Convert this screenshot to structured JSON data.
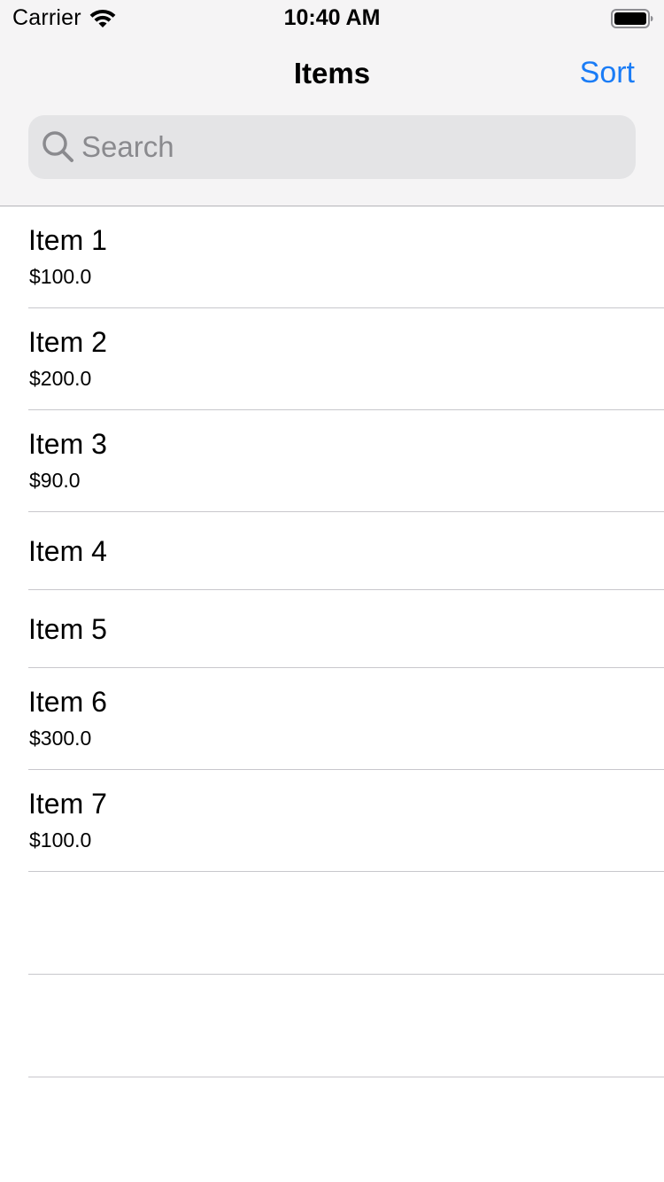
{
  "status_bar": {
    "carrier": "Carrier",
    "time": "10:40 AM",
    "icons": [
      "wifi-icon",
      "battery-icon"
    ]
  },
  "nav": {
    "title": "Items",
    "sort_label": "Sort",
    "accent_color": "#1a7cf6"
  },
  "search": {
    "placeholder": "Search",
    "value": "",
    "icon": "search-icon"
  },
  "items": [
    {
      "title": "Item 1",
      "price": "$100.0"
    },
    {
      "title": "Item 2",
      "price": "$200.0"
    },
    {
      "title": "Item 3",
      "price": "$90.0"
    },
    {
      "title": "Item 4",
      "price": ""
    },
    {
      "title": "Item 5",
      "price": ""
    },
    {
      "title": "Item 6",
      "price": "$300.0"
    },
    {
      "title": "Item 7",
      "price": "$100.0"
    }
  ]
}
